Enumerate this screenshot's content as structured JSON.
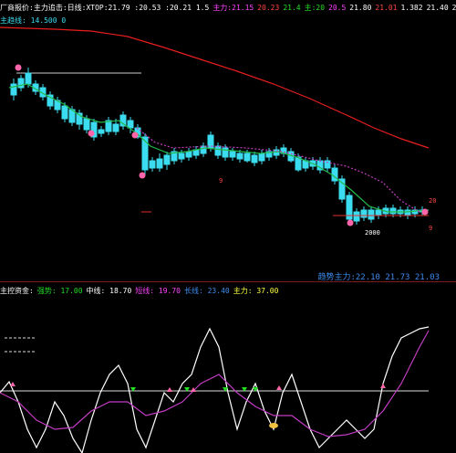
{
  "colors": {
    "background": "#000000",
    "ma_long": "#e81e1e",
    "ma_short": "#22b84a",
    "ma_purple": "#c23cc2",
    "candle_up": "#e03030",
    "candle_down": "#3cdcf0",
    "osc_white": "#ffffff",
    "osc_purple": "#c23cc2",
    "signal_green": "#22dd22",
    "signal_pink": "#ff66aa"
  },
  "top_header": [
    {
      "text": "厂商报价:主力追击:日线:XTOP:21.79 :20.53 :20.21 1.5",
      "color": "#ffffff"
    },
    {
      "text": "主力:21.15",
      "color": "#ff44ff"
    },
    {
      "text": "20.23",
      "color": "#ff4444"
    },
    {
      "text": "21.4",
      "color": "#22dd22"
    },
    {
      "text": "主:20",
      "color": "#22dd22"
    },
    {
      "text": "20.5",
      "color": "#ff44ff"
    },
    {
      "text": "21.80",
      "color": "#ffffff"
    },
    {
      "text": "21.01",
      "color": "#ff4444"
    },
    {
      "text": "1.382",
      "color": "#ffffff"
    },
    {
      "text": "21.40",
      "color": "#ffffff"
    },
    {
      "text": "21.00",
      "color": "#ffffff"
    }
  ],
  "top_sub": [
    {
      "text": "主趋线: 14.500 0",
      "color": "#3cdcf0"
    }
  ],
  "bottom_header": [
    {
      "text": "主控资金:",
      "color": "#ffffff"
    },
    {
      "text": "强势: 17.00",
      "color": "#22dd22"
    },
    {
      "text": "中线: 18.70",
      "color": "#ffffff"
    },
    {
      "text": "短线: 19.70",
      "color": "#ff44ff"
    },
    {
      "text": "长线: 23.40",
      "color": "#3c8cf0"
    },
    {
      "text": "主力: 37.00",
      "color": "#ffff44"
    }
  ],
  "bottom_right": {
    "text": "趋势主力:22.10 21.73 21.03",
    "color": "#3c8cf0"
  },
  "price_labels": [
    {
      "text": "20",
      "color": "#ff4444"
    },
    {
      "text": "9",
      "color": "#ff4444"
    },
    {
      "text": "2000",
      "color": "#ffffff"
    },
    {
      "text": "9",
      "color": "#ff4444"
    }
  ],
  "icons": [
    "flower-marker-icon",
    "up-arrow-icon",
    "down-arrow-icon",
    "fish-icon"
  ]
}
